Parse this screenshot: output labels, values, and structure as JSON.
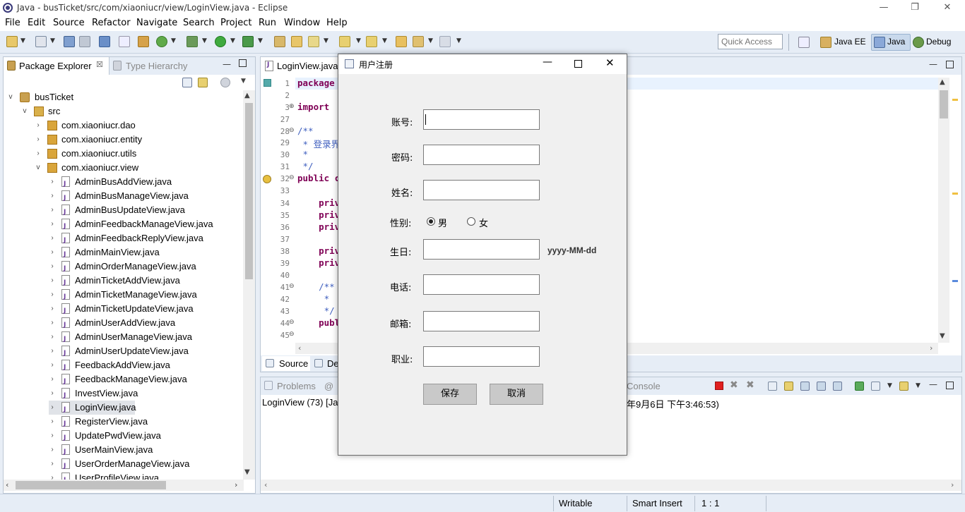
{
  "window": {
    "title": "Java - busTicket/src/com/xiaoniucr/view/LoginView.java - Eclipse",
    "controls": {
      "minimize": "—",
      "restore": "❐",
      "close": "✕"
    }
  },
  "menu": [
    "File",
    "Edit",
    "Source",
    "Refactor",
    "Navigate",
    "Search",
    "Project",
    "Run",
    "Window",
    "Help"
  ],
  "toolbar": {
    "quick_access": "Quick Access",
    "perspectives": [
      "Java EE",
      "Java",
      "Debug"
    ]
  },
  "package_explorer": {
    "tab_label": "Package Explorer",
    "tab_close": "☒",
    "type_hierarchy_label": "Type Hierarchy",
    "project": "busTicket",
    "src": "src",
    "packages": [
      "com.xiaoniucr.dao",
      "com.xiaoniucr.entity",
      "com.xiaoniucr.utils",
      "com.xiaoniucr.view"
    ],
    "files": [
      "AdminBusAddView.java",
      "AdminBusManageView.java",
      "AdminBusUpdateView.java",
      "AdminFeedbackManageView.java",
      "AdminFeedbackReplyView.java",
      "AdminMainView.java",
      "AdminOrderManageView.java",
      "AdminTicketAddView.java",
      "AdminTicketManageView.java",
      "AdminTicketUpdateView.java",
      "AdminUserAddView.java",
      "AdminUserManageView.java",
      "AdminUserUpdateView.java",
      "FeedbackAddView.java",
      "FeedbackManageView.java",
      "InvestView.java",
      "LoginView.java",
      "RegisterView.java",
      "UpdatePwdView.java",
      "UserMainView.java",
      "UserOrderManageView.java",
      "UserProfileView.java"
    ],
    "selected_file": "LoginView.java"
  },
  "editor": {
    "tab_label": "LoginView.java",
    "lines": [
      {
        "n": "1",
        "code": "package"
      },
      {
        "n": "2",
        "code": ""
      },
      {
        "n": "3",
        "code": "import "
      },
      {
        "n": "27",
        "code": ""
      },
      {
        "n": "28",
        "code": "/**"
      },
      {
        "n": "29",
        "code": " * 登录界"
      },
      {
        "n": "30",
        "code": " *"
      },
      {
        "n": "31",
        "code": " */"
      },
      {
        "n": "32",
        "code": "public c"
      },
      {
        "n": "33",
        "code": ""
      },
      {
        "n": "34",
        "code": "    priv"
      },
      {
        "n": "35",
        "code": "    priv"
      },
      {
        "n": "36",
        "code": "    priv"
      },
      {
        "n": "37",
        "code": ""
      },
      {
        "n": "38",
        "code": "    priv"
      },
      {
        "n": "39",
        "code": "    priv"
      },
      {
        "n": "40",
        "code": ""
      },
      {
        "n": "41",
        "code": "    /**"
      },
      {
        "n": "42",
        "code": "     * "
      },
      {
        "n": "43",
        "code": "     */"
      },
      {
        "n": "44",
        "code": "    publ"
      },
      {
        "n": "45",
        "code": ""
      }
    ],
    "bottom_tabs": [
      "Source",
      "De"
    ]
  },
  "bottom_panel": {
    "problems_label": "Problems",
    "at_label": "@",
    "console_label": "Console",
    "console_line_left": "LoginView (73) [Jav",
    "console_line_right": "年9月6日 下午3:46:53)"
  },
  "dialog": {
    "title": "用户注册",
    "fields": [
      {
        "label": "账号:",
        "value": ""
      },
      {
        "label": "密码:",
        "value": ""
      },
      {
        "label": "姓名:",
        "value": ""
      },
      {
        "label": "生日:",
        "value": "",
        "hint": "yyyy-MM-dd"
      },
      {
        "label": "电话:",
        "value": ""
      },
      {
        "label": "邮箱:",
        "value": ""
      },
      {
        "label": "职业:",
        "value": ""
      }
    ],
    "gender_label": "性别:",
    "gender_options": [
      "男",
      "女"
    ],
    "gender_selected": "男",
    "save_button": "保存",
    "cancel_button": "取消"
  },
  "statusbar": {
    "writable": "Writable",
    "insert_mode": "Smart Insert",
    "position": "1 : 1"
  }
}
